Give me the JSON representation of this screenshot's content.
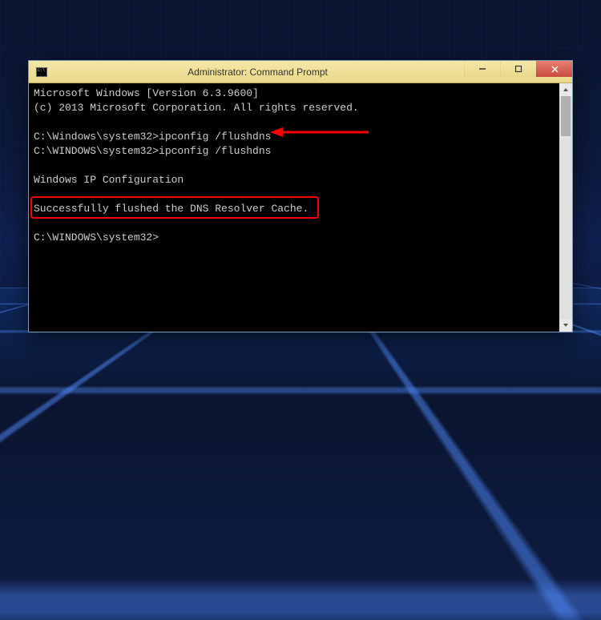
{
  "window": {
    "title": "Administrator: Command Prompt"
  },
  "terminal": {
    "lines": [
      "Microsoft Windows [Version 6.3.9600]",
      "(c) 2013 Microsoft Corporation. All rights reserved.",
      "",
      "C:\\Windows\\system32>ipconfig /flushdns",
      "C:\\WINDOWS\\system32>ipconfig /flushdns",
      "",
      "Windows IP Configuration",
      "",
      "Successfully flushed the DNS Resolver Cache.",
      "",
      "C:\\WINDOWS\\system32>"
    ]
  },
  "annotations": {
    "highlight_color": "#ff0000",
    "arrow_color": "#ff0000"
  }
}
